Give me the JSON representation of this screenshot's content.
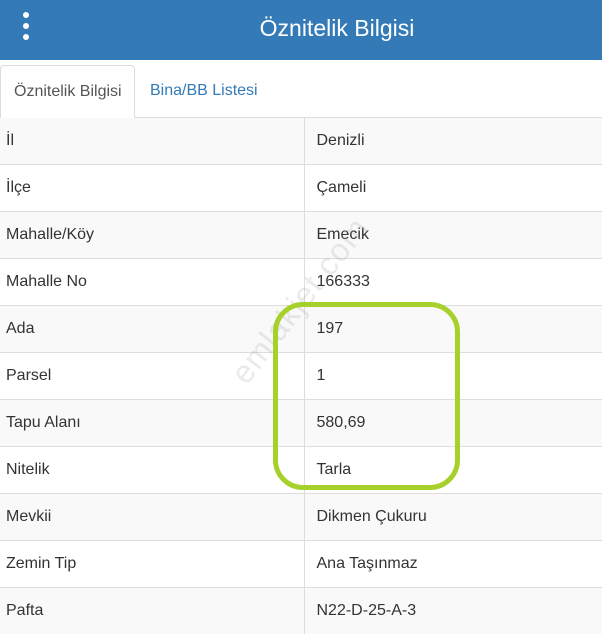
{
  "header": {
    "title": "Öznitelik Bilgisi",
    "menu_icon": "vertical-dots-icon",
    "background": "#337ab7"
  },
  "tabs": [
    {
      "label": "Öznitelik Bilgisi",
      "active": true
    },
    {
      "label": "Bina/BB Listesi",
      "active": false
    }
  ],
  "rows": [
    {
      "key": "İl",
      "value": "Denizli"
    },
    {
      "key": "İlçe",
      "value": "Çameli"
    },
    {
      "key": "Mahalle/Köy",
      "value": "Emecik"
    },
    {
      "key": "Mahalle No",
      "value": "166333"
    },
    {
      "key": "Ada",
      "value": "197"
    },
    {
      "key": "Parsel",
      "value": "1"
    },
    {
      "key": "Tapu Alanı",
      "value": "580,69"
    },
    {
      "key": "Nitelik",
      "value": "Tarla"
    },
    {
      "key": "Mevkii",
      "value": "Dikmen Çukuru"
    },
    {
      "key": "Zemin Tip",
      "value": "Ana Taşınmaz"
    },
    {
      "key": "Pafta",
      "value": "N22-D-25-A-3"
    }
  ],
  "watermark": "emlakjet.com",
  "highlight_color": "#a6d12a"
}
